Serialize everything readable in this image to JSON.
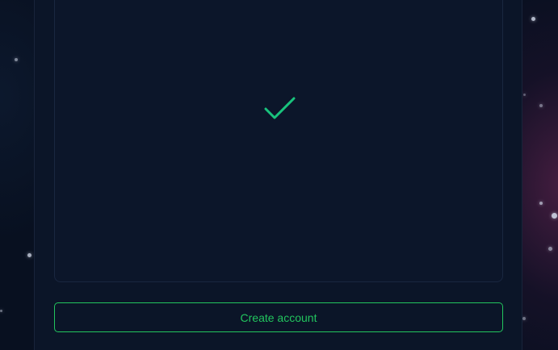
{
  "colors": {
    "accent": "#22c55e",
    "check": "#19c37d",
    "panel_bg": "#0b1528",
    "page_bg": "#081020"
  },
  "status": {
    "icon": "check-icon"
  },
  "actions": {
    "create_account_label": "Create account"
  }
}
